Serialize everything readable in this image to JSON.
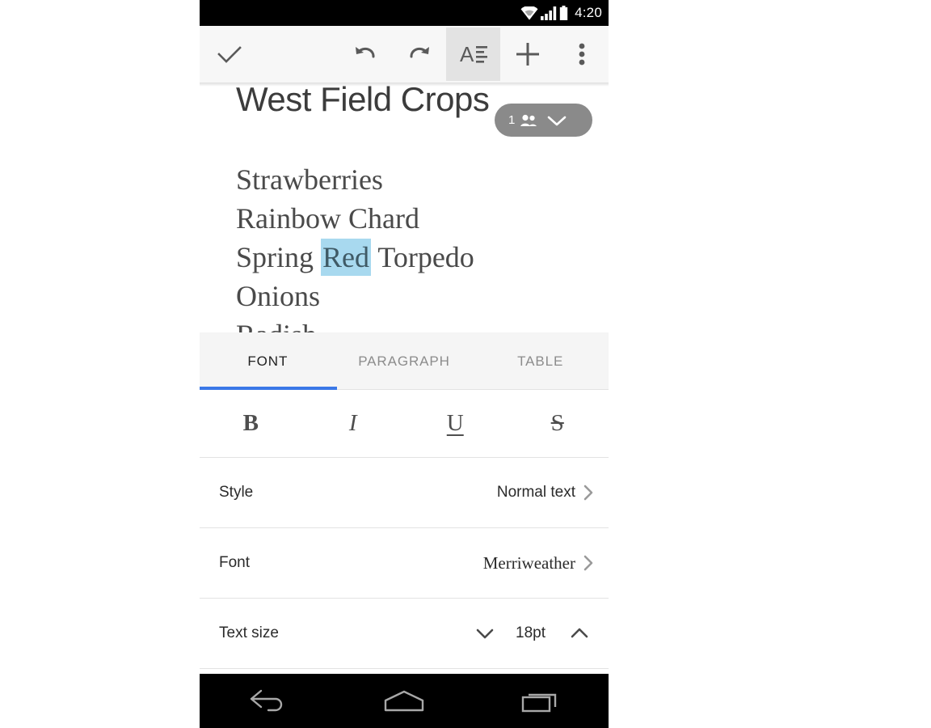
{
  "status_bar": {
    "time": "4:20",
    "icons": [
      "wifi-icon",
      "signal-icon",
      "battery-icon"
    ]
  },
  "toolbar": {
    "done_label": "check-icon",
    "undo_label": "undo-icon",
    "redo_label": "redo-icon",
    "format_label": "format-text-icon",
    "add_label": "plus-icon",
    "more_label": "overflow-menu-icon",
    "active_button": "format-text-icon",
    "selected_bg": "#e3e3e3",
    "background": "#f7f7f7"
  },
  "document": {
    "title": "West Field Crops",
    "collaborators": {
      "count": "1",
      "people_icon": "people-icon",
      "chevron_icon": "chevron-down-icon",
      "pill_color": "#8a8a8a"
    },
    "lines": [
      {
        "text": "Strawberries",
        "selection": null
      },
      {
        "text": "Rainbow Chard",
        "selection": null
      },
      {
        "before": "Spring ",
        "selection": "Red",
        "after": " Torpedo"
      },
      {
        "text": "Onions",
        "selection": null
      }
    ],
    "clipped_line": "Radish",
    "selection_color": "#a8d9ef"
  },
  "panel": {
    "tabs": [
      {
        "label": "FONT",
        "active": true
      },
      {
        "label": "PARAGRAPH",
        "active": false
      },
      {
        "label": "TABLE",
        "active": false
      }
    ],
    "active_indicator_color": "#3b78e7",
    "style_buttons": [
      {
        "label": "B",
        "name": "bold-button"
      },
      {
        "label": "I",
        "name": "italic-button"
      },
      {
        "label": "U",
        "name": "underline-button"
      },
      {
        "label": "S",
        "name": "strikethrough-button"
      }
    ],
    "options": [
      {
        "label": "Style",
        "value": "Normal text",
        "chevron": "chevron-right-icon"
      },
      {
        "label": "Font",
        "value": "Merriweather",
        "chevron": "chevron-right-icon"
      }
    ],
    "text_size": {
      "label": "Text size",
      "value": "18pt",
      "decrease_icon": "chevron-down-icon",
      "increase_icon": "chevron-up-icon"
    }
  },
  "nav_bar": {
    "back_label": "back-nav-icon",
    "home_label": "home-nav-icon",
    "recents_label": "recents-nav-icon"
  }
}
